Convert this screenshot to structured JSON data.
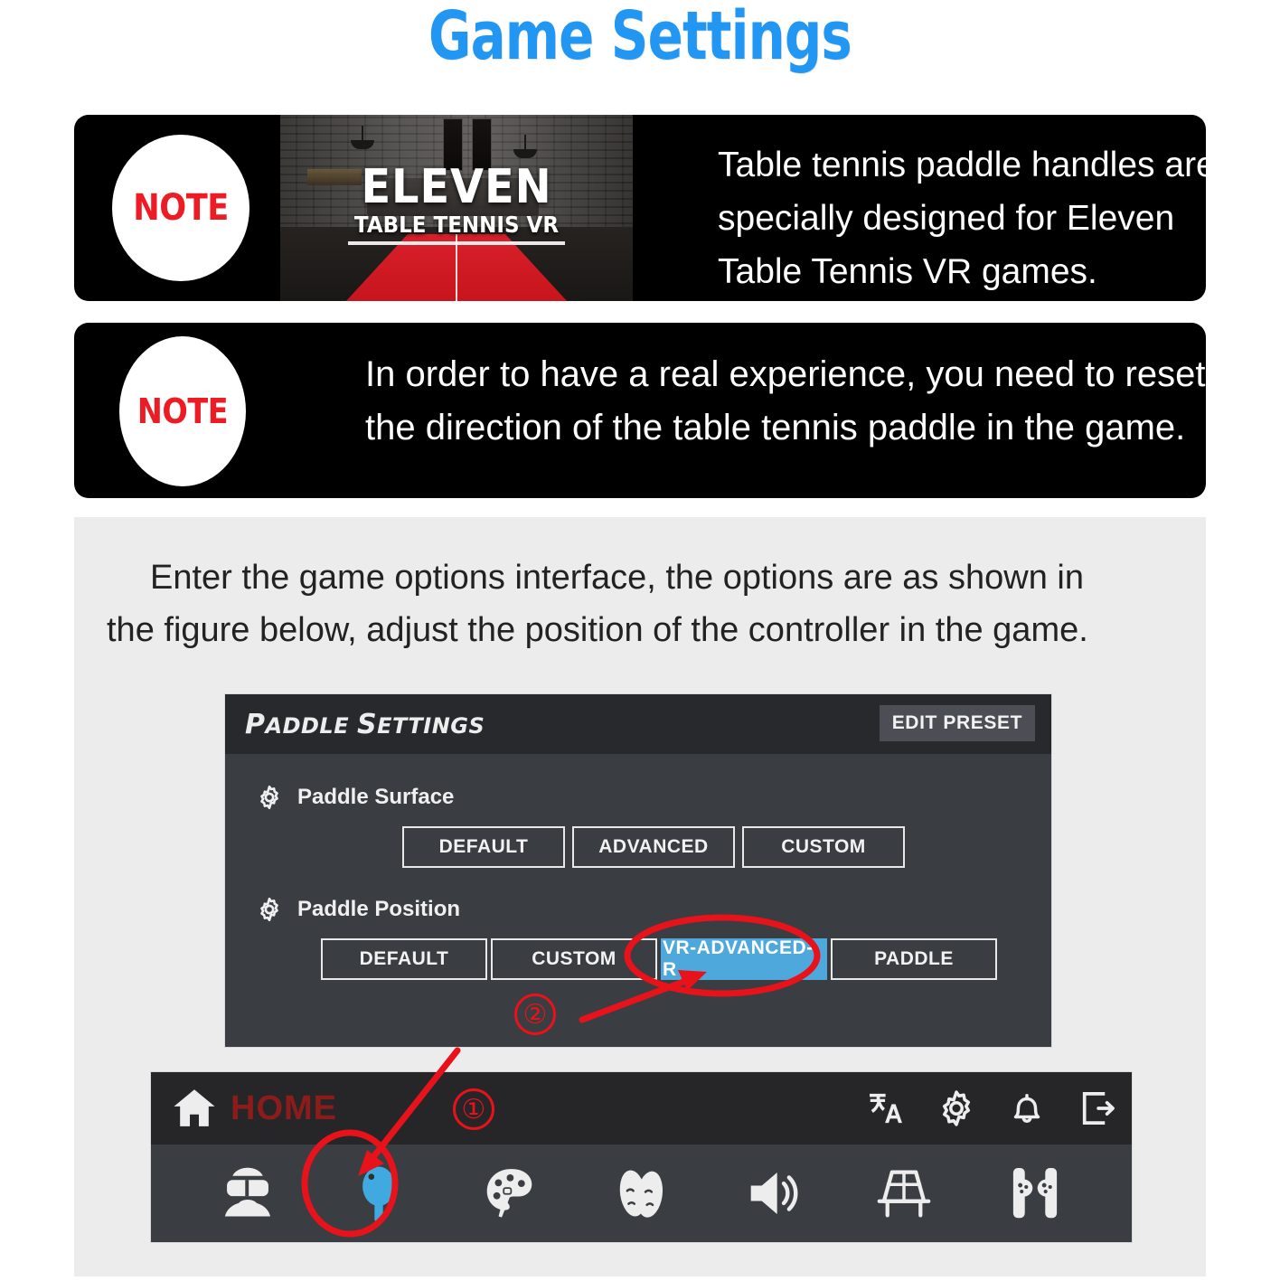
{
  "page": {
    "title": "Game Settings"
  },
  "notes": [
    {
      "badge": "NOTE",
      "thumbnail": {
        "line1": "ELEVEN",
        "line2": "TABLE TENNIS VR"
      },
      "lines": [
        "Table tennis paddle handles are",
        "specially designed for Eleven",
        "Table Tennis VR games."
      ]
    },
    {
      "badge": "NOTE",
      "lines": [
        "In order to have a real experience, you need to reset",
        "the direction of the table tennis paddle in the game."
      ]
    }
  ],
  "instruction": {
    "line1": "Enter the game options interface, the options are as shown in",
    "line2": "the figure below, adjust the position of the controller in the game."
  },
  "settings_panel": {
    "title_part1": "P",
    "title_part2": "ADDLE ",
    "title_part3": "S",
    "title_part4": "ETTINGS",
    "edit_preset_label": "EDIT PRESET",
    "rows": [
      {
        "label": "Paddle Surface",
        "icon": "gear-icon",
        "options": [
          "DEFAULT",
          "ADVANCED",
          "CUSTOM"
        ],
        "selected": null
      },
      {
        "label": "Paddle Position",
        "icon": "gear-icon",
        "options": [
          "DEFAULT",
          "CUSTOM",
          "VR-ADVANCED-R",
          "PADDLE"
        ],
        "selected": "VR-ADVANCED-R"
      }
    ]
  },
  "home_bar": {
    "home_label": "HOME",
    "home_icon": "home-icon",
    "right_icons": [
      "translate-icon",
      "gear-icon",
      "bell-icon",
      "exit-icon"
    ],
    "bottom_icons": [
      "vr-avatar-icon",
      "paddle-icon",
      "palette-icon",
      "masks-icon",
      "speaker-icon",
      "table-icon",
      "controllers-icon"
    ],
    "selected_bottom_icon": "paddle-icon"
  },
  "annotations": {
    "marker_one": "①",
    "marker_two": "②"
  },
  "colors": {
    "title_blue": "#2196F3",
    "note_red": "#ED1C24",
    "annotation_red": "#E8121B",
    "highlight_blue": "#4FA8DC",
    "panel_body": "#3A3D42",
    "panel_header": "#28292C",
    "gray_bg": "#ECECEC",
    "home_label_red": "#8C1C1C"
  }
}
